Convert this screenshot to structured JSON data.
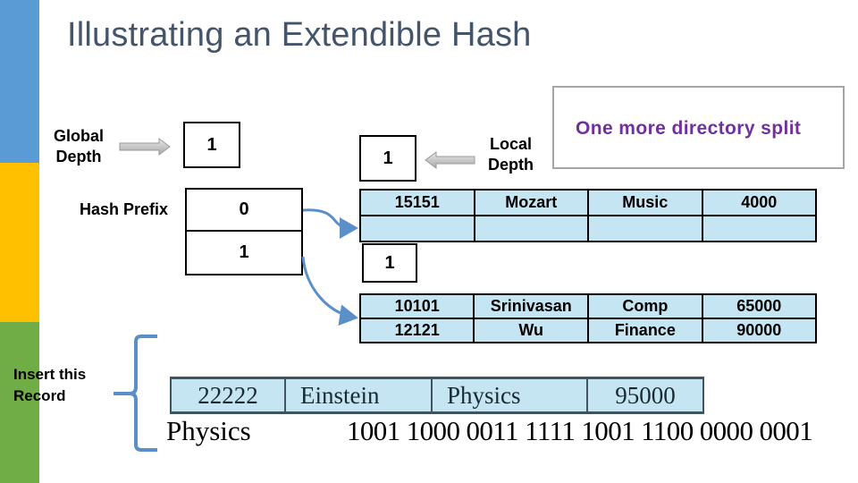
{
  "slide": {
    "title": "Illustrating an Extendible Hash",
    "accent_colors": {
      "blue": "#5b9bd5",
      "yellow": "#ffc000",
      "green": "#70ad47"
    }
  },
  "labels": {
    "global_depth_line1": "Global",
    "global_depth_line2": "Depth",
    "hash_prefix": "Hash Prefix",
    "local_depth_line1": "Local",
    "local_depth_line2": "Depth",
    "insert_line1": "Insert this",
    "insert_line2": "Record"
  },
  "global_depth": "1",
  "directory": {
    "entries": [
      "0",
      "1"
    ]
  },
  "buckets": [
    {
      "local_depth": "1",
      "rows": [
        [
          "15151",
          "Mozart",
          "Music",
          "4000"
        ],
        [
          "",
          "",
          "",
          ""
        ]
      ]
    },
    {
      "local_depth": "1",
      "rows": [
        [
          "10101",
          "Srinivasan",
          "Comp",
          "65000"
        ],
        [
          "12121",
          "Wu",
          "Finance",
          "90000"
        ]
      ]
    }
  ],
  "note": {
    "text": "One more directory split",
    "color": "#7030a0"
  },
  "new_record": {
    "cells": [
      "22222",
      "Einstein",
      "Physics",
      "95000"
    ],
    "hash_key": "Physics",
    "hash_bits": "1001 1000 0011 1111 1001 1100 0000 0001"
  }
}
